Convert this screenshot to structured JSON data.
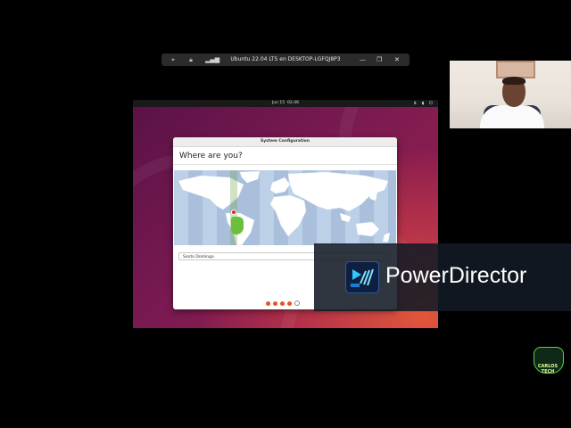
{
  "rdp": {
    "title": "Ubuntu 22.04 LTS en DESKTOP-LGFQJ8P3",
    "icons": [
      "pin-icon",
      "lock-icon",
      "signal-icon"
    ],
    "minimize": "—",
    "restore": "❐",
    "close": "✕"
  },
  "vm": {
    "topbar": {
      "date": "Jun 15",
      "time": "02:46",
      "tray": "⋔ ◖ ⏻"
    },
    "dialog": {
      "title": "System Configuration",
      "question": "Where are you?",
      "location": "Santo Domingo",
      "steps_done": 4,
      "steps_total": 5
    }
  },
  "overlay": {
    "brand": "PowerDirector"
  },
  "watermark": {
    "label": "CARLOS TECH"
  },
  "colors": {
    "accent": "#e95420",
    "land": "#ffffff",
    "water": "#a9bfdc",
    "highlight": "#6bbf3a"
  }
}
